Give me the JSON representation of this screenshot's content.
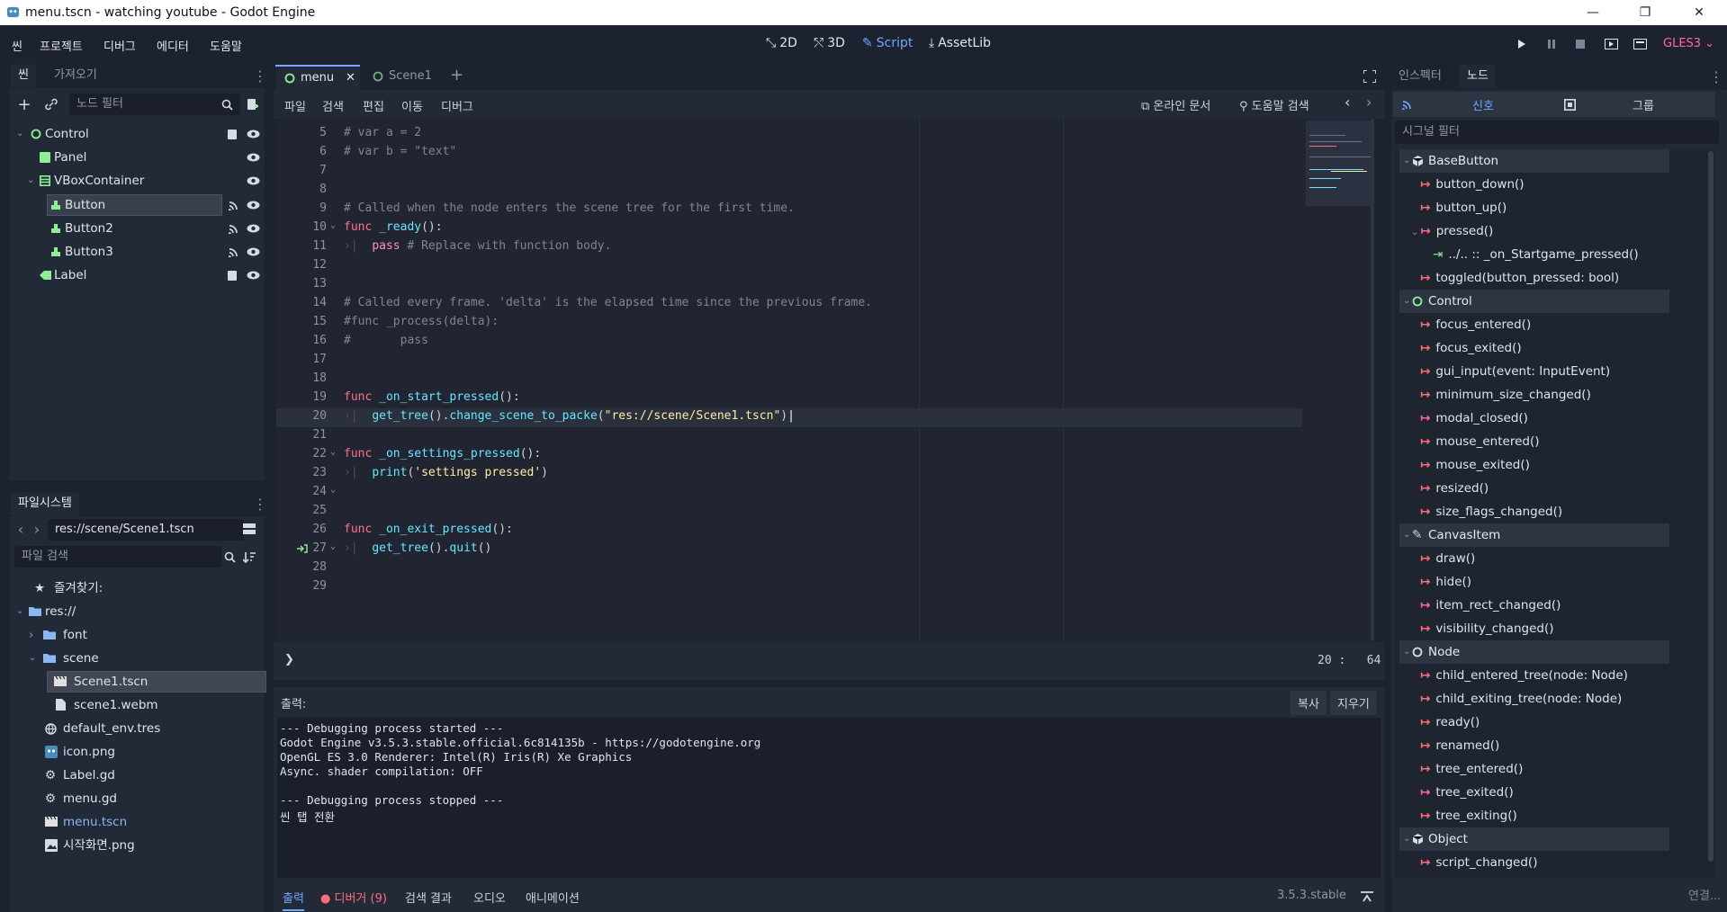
{
  "window": {
    "title": "menu.tscn - watching youtube - Godot Engine",
    "minimize": "—",
    "restore": "❐",
    "close": "✕"
  },
  "menubar": {
    "items": [
      "씬",
      "프로젝트",
      "디버그",
      "에디터",
      "도움말"
    ],
    "modes": {
      "two_d": "2D",
      "three_d": "3D",
      "script": "Script",
      "assetlib": "AssetLib"
    },
    "renderer": "GLES3 ⌄"
  },
  "scene_dock": {
    "tabs": [
      "씬",
      "가져오기"
    ],
    "filter_placeholder": "노드 필터",
    "nodes": [
      {
        "label": "Control",
        "icon": "control-icon",
        "color": "#8eef97"
      },
      {
        "label": "Panel",
        "icon": "panel-icon",
        "color": "#8eef97"
      },
      {
        "label": "VBoxContainer",
        "icon": "vbox-icon",
        "color": "#8eef97"
      },
      {
        "label": "Button",
        "icon": "button-icon",
        "color": "#8eef97"
      },
      {
        "label": "Button2",
        "icon": "button-icon",
        "color": "#8eef97"
      },
      {
        "label": "Button3",
        "icon": "button-icon",
        "color": "#8eef97"
      },
      {
        "label": "Label",
        "icon": "label-icon",
        "color": "#8eef97"
      }
    ]
  },
  "filesystem_dock": {
    "tab": "파일시스템",
    "path": "res://scene/Scene1.tscn",
    "search_placeholder": "파일 검색",
    "favorites": "즐겨찾기:",
    "entries": [
      "res://",
      "font",
      "scene",
      "Scene1.tscn",
      "scene1.webm",
      "default_env.tres",
      "icon.png",
      "Label.gd",
      "menu.gd",
      "menu.tscn",
      "시작화면.png"
    ]
  },
  "editor_tabs": [
    {
      "label": "menu",
      "close": "✕"
    },
    {
      "label": "Scene1"
    }
  ],
  "add_tab": "+",
  "script_menu": {
    "items": [
      "파일",
      "검색",
      "편집",
      "이동",
      "디버그"
    ],
    "online_docs": "온라인 문서",
    "help_search": "도움말 검색"
  },
  "code": {
    "line_numbers": [
      "5",
      "6",
      "7",
      "8",
      "9",
      "10",
      "11",
      "12",
      "13",
      "14",
      "15",
      "16",
      "17",
      "18",
      "19",
      "20",
      "21",
      "22",
      "23",
      "24",
      "25",
      "26",
      "27",
      "28",
      "29"
    ],
    "l5": "# var a = 2",
    "l6": "# var b = \"text\"",
    "l9": "# Called when the node enters the scene tree for the first time.",
    "l10_kw": "func",
    "l10_fn": "_ready",
    "l10_rest": "():",
    "l11_kw": "pass",
    "l11_comment": " # Replace with function body.",
    "l14": "# Called every frame. 'delta' is the elapsed time since the previous frame.",
    "l15": "#func _process(delta):",
    "l16": "#\tpass",
    "l19_kw": "func",
    "l19_fn": "_on_start_pressed",
    "l19_rest": "():",
    "l20_fn1": "get_tree",
    "l20_mid": "().",
    "l20_fn2": "change_scene_to_packe",
    "l20_p1": "(",
    "l20_str": "\"res://scene/Scene1.tscn\"",
    "l20_p2": ")",
    "l22_kw": "func",
    "l22_fn": "_on_settings_pressed",
    "l22_rest": "():",
    "l23_fn": "print",
    "l23_p1": "(",
    "l23_str": "'settings pressed'",
    "l23_p2": ")",
    "l26_kw": "func",
    "l26_fn": "_on_exit_pressed",
    "l26_rest": "():",
    "l27_fn1": "get_tree",
    "l27_mid": "().",
    "l27_fn2": "quit",
    "l27_rest": "()",
    "cursor": "20 :   64",
    "console_prompt": "❯"
  },
  "output": {
    "label": "출력:",
    "copy": "복사",
    "clear": "지우기",
    "lines": [
      "--- Debugging process started ---",
      "Godot Engine v3.5.3.stable.official.6c814135b - https://godotengine.org",
      "OpenGL ES 3.0 Renderer: Intel(R) Iris(R) Xe Graphics",
      "Async. shader compilation: OFF",
      "",
      "--- Debugging process stopped ---",
      "씬 탭 전환"
    ]
  },
  "bottom_tabs": {
    "output": "출력",
    "debugger": "디버거 (9)",
    "search_results": "검색 결과",
    "audio": "오디오",
    "animation": "애니메이션",
    "version": "3.5.3.stable"
  },
  "right_dock": {
    "tabs": [
      "인스펙터",
      "노드"
    ],
    "subtabs": {
      "signals": "신호",
      "groups": "그룹"
    },
    "filter_placeholder": "시그널 필터",
    "connect": "연결...",
    "sections": [
      {
        "name": "BaseButton",
        "signals": [
          "button_down()",
          "button_up()",
          "pressed()",
          "../.. :: _on_Startgame_pressed()",
          "toggled(button_pressed: bool)"
        ]
      },
      {
        "name": "Control",
        "signals": [
          "focus_entered()",
          "focus_exited()",
          "gui_input(event: InputEvent)",
          "minimum_size_changed()",
          "modal_closed()",
          "mouse_entered()",
          "mouse_exited()",
          "resized()",
          "size_flags_changed()"
        ]
      },
      {
        "name": "CanvasItem",
        "signals": [
          "draw()",
          "hide()",
          "item_rect_changed()",
          "visibility_changed()"
        ]
      },
      {
        "name": "Node",
        "signals": [
          "child_entered_tree(node: Node)",
          "child_exiting_tree(node: Node)",
          "ready()",
          "renamed()",
          "tree_entered()",
          "tree_exited()",
          "tree_exiting()"
        ]
      },
      {
        "name": "Object",
        "signals": [
          "script_changed()"
        ]
      }
    ]
  },
  "colors": {
    "accent": "#6fa8ff",
    "node_green": "#8eef97",
    "signal_red": "#ff6b7a",
    "debugger_red": "#ff6b7a"
  }
}
